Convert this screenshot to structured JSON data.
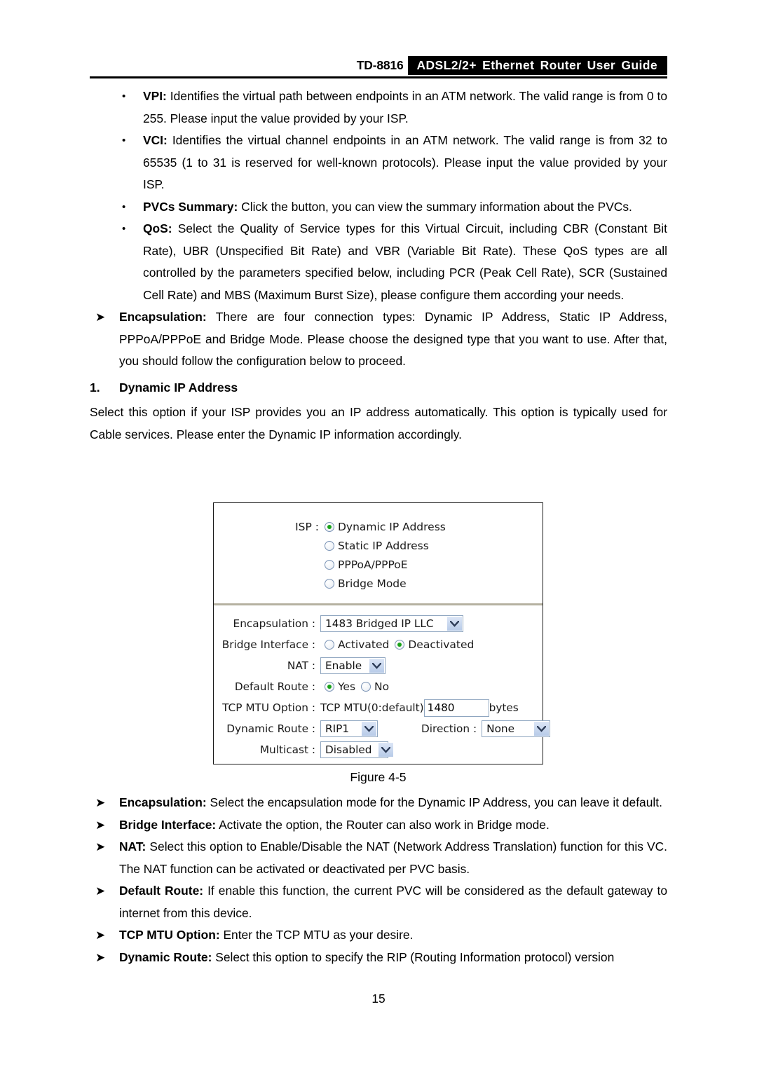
{
  "header": {
    "model": "TD-8816",
    "title": "ADSL2/2+ Ethernet Router User Guide"
  },
  "upper_bullets": [
    {
      "marker": "•",
      "term": "VPI:",
      "text": " Identifies the virtual path between endpoints in an ATM network. The valid range is from 0 to 255. Please input the value provided by your ISP."
    },
    {
      "marker": "•",
      "term": "VCI:",
      "text": " Identifies the virtual channel endpoints in an ATM network. The valid range is from 32 to 65535 (1 to 31 is reserved for well-known protocols). Please input the value provided by your ISP."
    },
    {
      "marker": "•",
      "term": "PVCs Summary:",
      "text": " Click the button, you can view the summary information about the PVCs."
    },
    {
      "marker": "•",
      "term": "QoS:",
      "text": " Select the Quality of Service types for this Virtual Circuit, including CBR (Constant Bit Rate), UBR (Unspecified Bit Rate) and VBR (Variable Bit Rate). These QoS types are all controlled by the parameters specified below, including PCR (Peak Cell Rate), SCR (Sustained Cell Rate) and MBS (Maximum Burst Size), please configure them according your needs."
    }
  ],
  "encapsulation_intro": {
    "marker": "➤",
    "term": "Encapsulation:",
    "text": " There are four connection types: Dynamic IP Address, Static IP Address, PPPoA/PPPoE and Bridge Mode. Please choose the designed type that you want to use. After that, you should follow the configuration below to proceed."
  },
  "section": {
    "number": "1.",
    "heading": "Dynamic IP Address",
    "body": "Select this option if your ISP provides you an IP address automatically. This option is typically used for Cable services. Please enter the Dynamic IP information accordingly."
  },
  "figure": {
    "caption": "Figure 4-5",
    "isp": {
      "label": "ISP :",
      "options": [
        {
          "label": "Dynamic IP Address",
          "selected": true
        },
        {
          "label": "Static IP Address",
          "selected": false
        },
        {
          "label": "PPPoA/PPPoE",
          "selected": false
        },
        {
          "label": "Bridge Mode",
          "selected": false
        }
      ]
    },
    "fields": {
      "encapsulation": {
        "label": "Encapsulation :",
        "value": "1483 Bridged IP LLC"
      },
      "bridge_interface": {
        "label": "Bridge Interface :",
        "options": [
          {
            "label": "Activated",
            "selected": false
          },
          {
            "label": "Deactivated",
            "selected": true
          }
        ]
      },
      "nat": {
        "label": "NAT :",
        "value": "Enable"
      },
      "default_route": {
        "label": "Default Route :",
        "options": [
          {
            "label": "Yes",
            "selected": true
          },
          {
            "label": "No",
            "selected": false
          }
        ]
      },
      "tcp_mtu": {
        "label": "TCP MTU Option :",
        "prefix": "TCP MTU(0:default)",
        "value": "1480",
        "unit": "bytes"
      },
      "dynamic_route": {
        "label": "Dynamic Route :",
        "value": "RIP1"
      },
      "direction": {
        "label": "Direction :",
        "value": "None"
      },
      "multicast": {
        "label": "Multicast :",
        "value": "Disabled"
      }
    }
  },
  "lower_bullets": [
    {
      "marker": "➤",
      "term": "Encapsulation:",
      "text": " Select the encapsulation mode for the Dynamic IP Address, you can leave it default."
    },
    {
      "marker": "➤",
      "term": "Bridge Interface:",
      "text": " Activate the option, the Router can also work in Bridge mode."
    },
    {
      "marker": "➤",
      "term": "NAT:",
      "text": " Select this option to Enable/Disable the NAT (Network Address Translation) function for this VC. The NAT function can be activated or deactivated per PVC basis."
    },
    {
      "marker": "➤",
      "term": "Default Route:",
      "text": " If enable this function, the current PVC will be considered as the default gateway to internet from this device."
    },
    {
      "marker": "➤",
      "term": "TCP MTU Option:",
      "text": " Enter the TCP MTU as your desire."
    },
    {
      "marker": "➤",
      "term": "Dynamic Route:",
      "text": " Select this option to specify the RIP (Routing Information protocol) version"
    }
  ],
  "page_number": "15",
  "colors": {
    "header_bar": "#000000",
    "radio_selected": "#19a319",
    "control_border": "#8fa6c0",
    "divider": "#b5b1a0"
  }
}
